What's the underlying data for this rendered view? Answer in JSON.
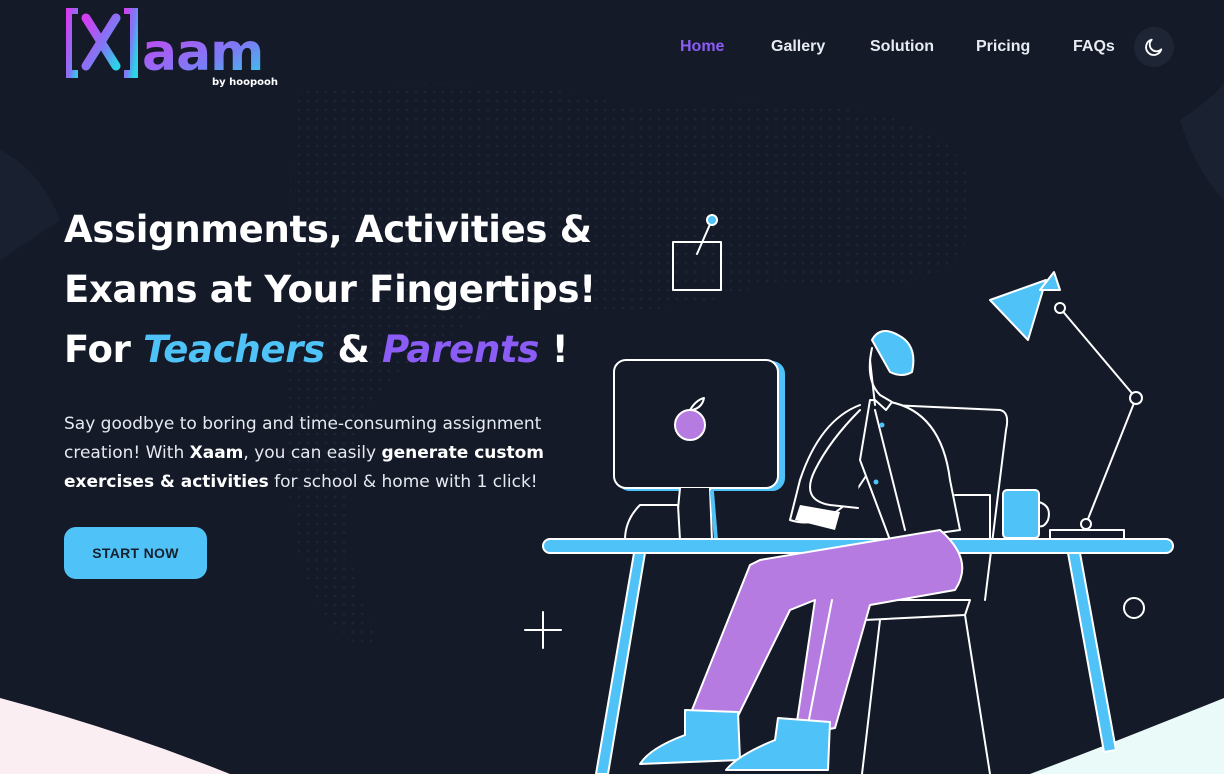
{
  "brand": {
    "logo_text": "aam",
    "logo_mark": "X",
    "logo_sub": "by hoopooh",
    "gradient_start": "#d43df0",
    "gradient_end": "#2bd4e6"
  },
  "nav": {
    "items": [
      {
        "label": "Home",
        "active": true
      },
      {
        "label": "Gallery",
        "active": false
      },
      {
        "label": "Solution",
        "active": false
      },
      {
        "label": "Pricing",
        "active": false
      },
      {
        "label": "FAQs",
        "active": false
      }
    ],
    "theme_toggle_icon": "moon-icon"
  },
  "hero": {
    "title_line1": "Assignments, Activities &",
    "title_line2": "Exams at Your Fingertips!",
    "title_for": "For",
    "title_teachers": "Teachers",
    "title_amp": "&",
    "title_parents": "Parents",
    "title_end": "!",
    "desc_1": "Say goodbye to boring and time-consuming assignment creation! With ",
    "desc_brand": "Xaam",
    "desc_2": ", you can easily ",
    "desc_bold": "generate custom exercises & activities",
    "desc_3": " for school & home with 1 click!",
    "cta_label": "START NOW"
  },
  "colors": {
    "background": "#141a28",
    "accent_blue": "#4fc3f7",
    "accent_purple": "#8b5cf6",
    "pants_purple": "#b57be0"
  }
}
